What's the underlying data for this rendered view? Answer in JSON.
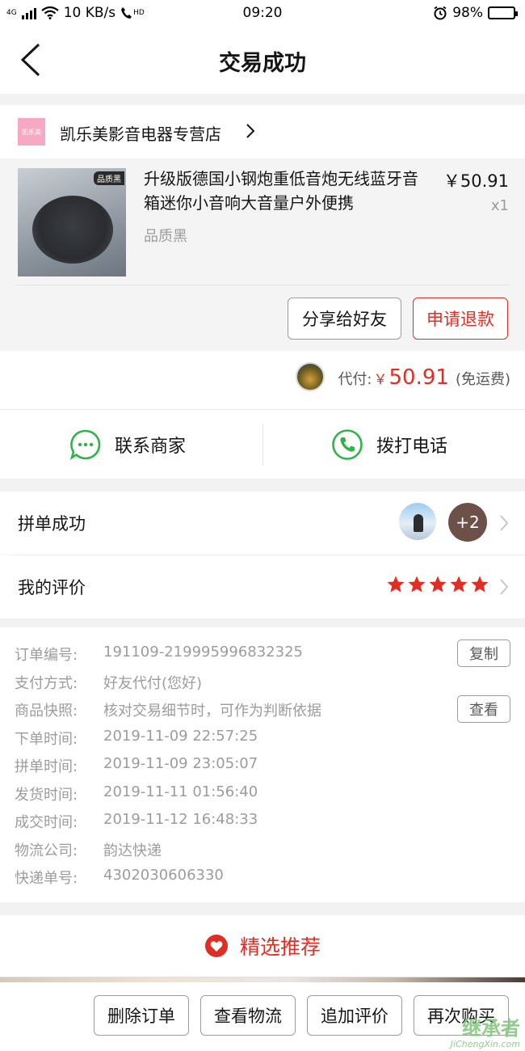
{
  "status_bar": {
    "network": "4G",
    "speed": "10 KB/s",
    "hd": "HD",
    "time": "09:20",
    "battery": "98%",
    "battery_level": 0.98
  },
  "header": {
    "title": "交易成功"
  },
  "store": {
    "logo_text": "凯乐美",
    "name": "凯乐美影音电器专营店"
  },
  "product": {
    "tag": "品质黑",
    "title": "升级版德国小钢炮重低音炮无线蓝牙音箱迷你小音响大音量户外便携",
    "spec": "品质黑",
    "price": "￥50.91",
    "qty": "x1",
    "share_button": "分享给好友",
    "refund_button": "申请退款"
  },
  "payment": {
    "label": "代付:",
    "currency": "￥",
    "amount": "50.91",
    "shipping": "(免运费)"
  },
  "contact": {
    "merchant": "联系商家",
    "call": "拨打电话"
  },
  "group": {
    "label": "拼单成功",
    "extra_count": "+2"
  },
  "review": {
    "label": "我的评价",
    "rating": 5,
    "max": 5
  },
  "order_info": {
    "rows": [
      {
        "key": "订单编号:",
        "value": "191109-219995996832325",
        "action": "复制"
      },
      {
        "key": "支付方式:",
        "value": "好友代付(您好)"
      },
      {
        "key": "商品快照:",
        "value": "核对交易细节时，可作为判断依据",
        "action": "查看"
      },
      {
        "key": "下单时间:",
        "value": "2019-11-09 22:57:25"
      },
      {
        "key": "拼单时间:",
        "value": "2019-11-09 23:05:07"
      },
      {
        "key": "发货时间:",
        "value": "2019-11-11 01:56:40"
      },
      {
        "key": "成交时间:",
        "value": "2019-11-12 16:48:33"
      },
      {
        "key": "物流公司:",
        "value": "韵达快递"
      },
      {
        "key": "快递单号:",
        "value": "4302030606330"
      }
    ]
  },
  "recommend": {
    "label": "精选推荐"
  },
  "bottom_actions": [
    "删除订单",
    "查看物流",
    "追加评价",
    "再次购买"
  ],
  "watermark": {
    "cn": "继承者",
    "en": "JiChengXin.com"
  },
  "colors": {
    "accent": "#e02e24",
    "wechat_green": "#2fb44a",
    "text": "#151516",
    "muted": "#9c9c9c"
  }
}
